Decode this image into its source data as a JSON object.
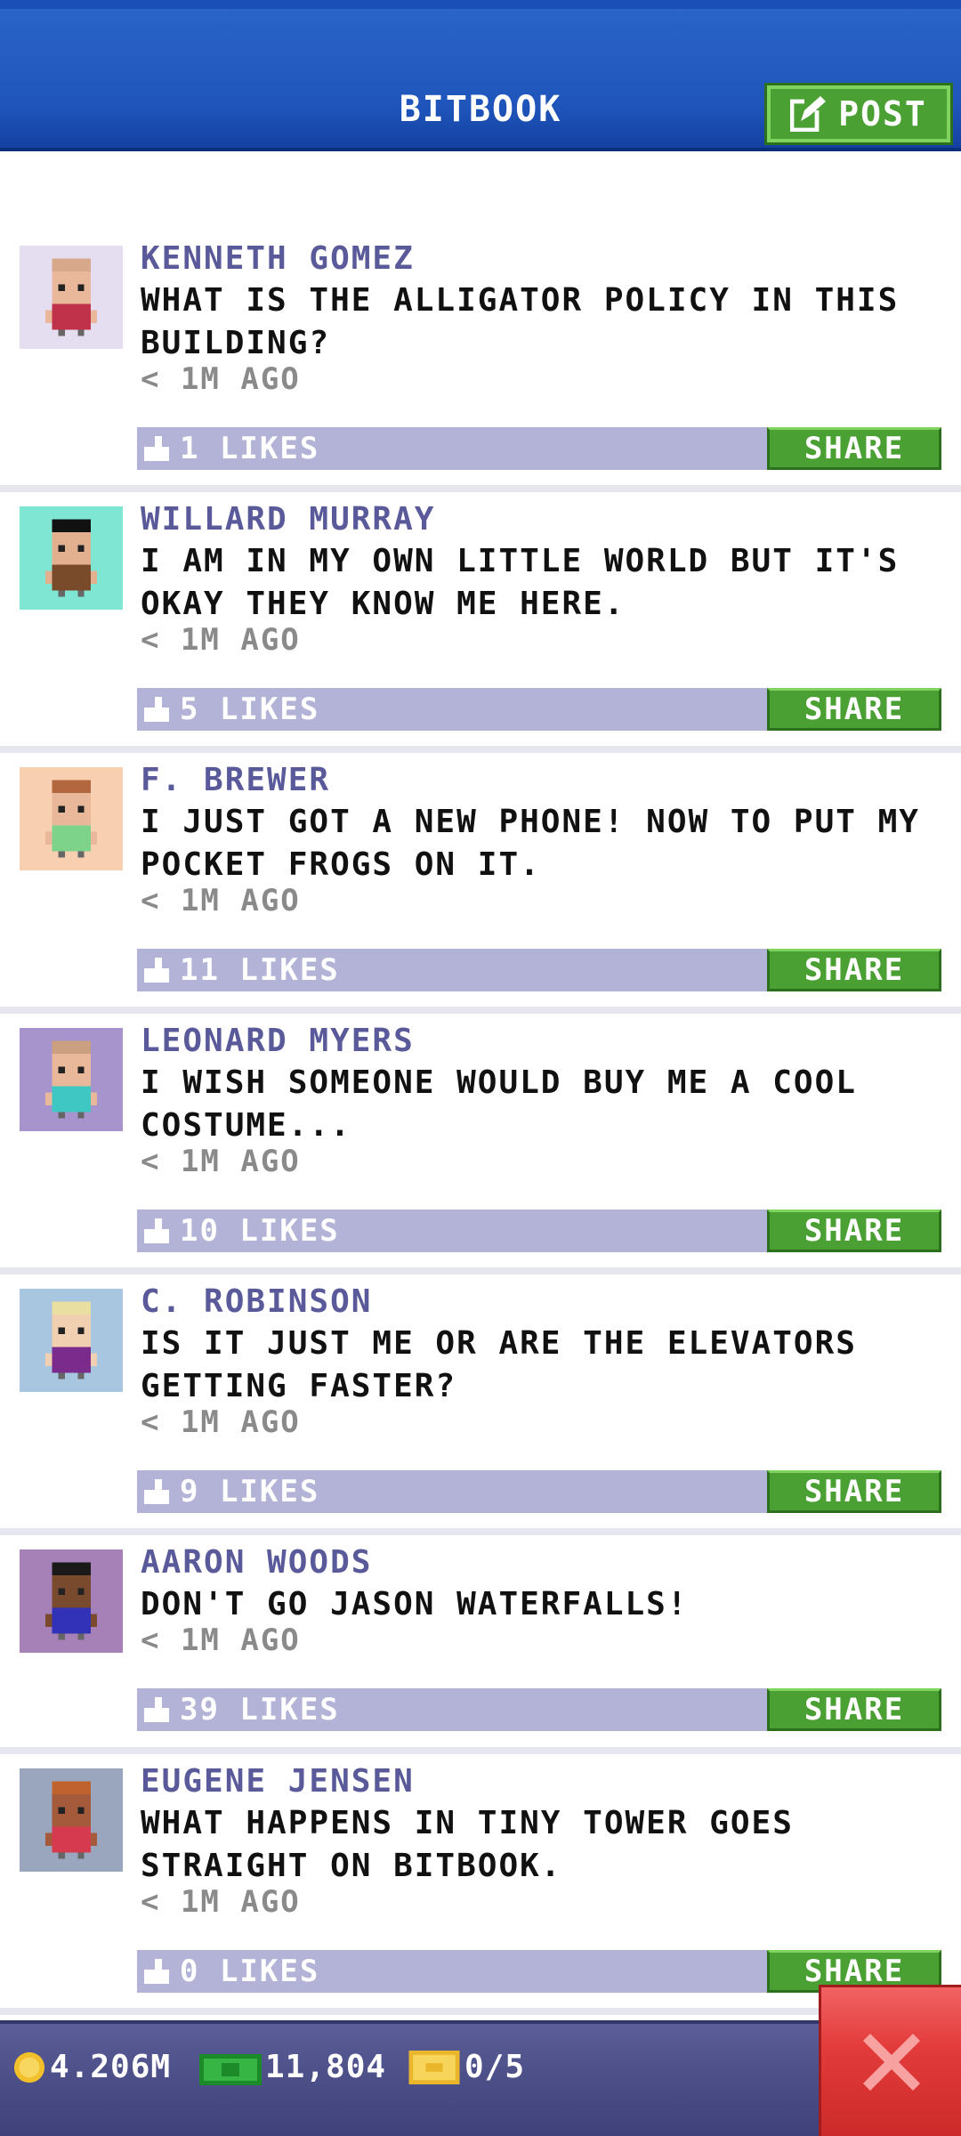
{
  "header": {
    "title": "BITBOOK",
    "post_label": "POST"
  },
  "posts": [
    {
      "name": "KENNETH GOMEZ",
      "message": "WHAT IS THE ALLIGATOR POLICY IN THIS BUILDING?",
      "time": "< 1M AGO",
      "likes": "1 LIKES",
      "share": "SHARE",
      "avatar_bg": "#e5ddf0",
      "shirt": "#c0324a",
      "skin": "#e9b89b",
      "hair": "#d7a98a"
    },
    {
      "name": "WILLARD MURRAY",
      "message": "I AM IN MY OWN LITTLE WORLD BUT IT'S OKAY THEY KNOW ME HERE.",
      "time": "< 1M AGO",
      "likes": "5 LIKES",
      "share": "SHARE",
      "avatar_bg": "#7fe6d3",
      "shirt": "#7a4b2a",
      "skin": "#e2b08f",
      "hair": "#111111"
    },
    {
      "name": "F. BREWER",
      "message": "I JUST GOT A NEW PHONE! NOW TO PUT MY POCKET FROGS ON IT.",
      "time": "< 1M AGO",
      "likes": "11 LIKES",
      "share": "SHARE",
      "avatar_bg": "#f8cfb0",
      "shirt": "#7ed38b",
      "skin": "#e9b89b",
      "hair": "#b3673e"
    },
    {
      "name": "LEONARD MYERS",
      "message": "I WISH SOMEONE WOULD BUY ME A COOL COSTUME...",
      "time": "< 1M AGO",
      "likes": "10 LIKES",
      "share": "SHARE",
      "avatar_bg": "#a794cc",
      "shirt": "#3fc7c4",
      "skin": "#e9b89b",
      "hair": "#caa080"
    },
    {
      "name": "C. ROBINSON",
      "message": "IS IT JUST ME OR ARE THE ELEVATORS GETTING FASTER?",
      "time": "< 1M AGO",
      "likes": "9 LIKES",
      "share": "SHARE",
      "avatar_bg": "#a8c6df",
      "shirt": "#7a2b8c",
      "skin": "#f1cfb1",
      "hair": "#e9dfa0"
    },
    {
      "name": "AARON WOODS",
      "message": "DON'T GO JASON WATERFALLS!",
      "time": "< 1M AGO",
      "likes": "39 LIKES",
      "share": "SHARE",
      "avatar_bg": "#a681b8",
      "shirt": "#3232b8",
      "skin": "#7a4a2e",
      "hair": "#1a1a1a"
    },
    {
      "name": "EUGENE JENSEN",
      "message": "WHAT HAPPENS IN TINY TOWER GOES STRAIGHT ON BITBOOK.",
      "time": "< 1M AGO",
      "likes": "0 LIKES",
      "share": "SHARE",
      "avatar_bg": "#9aa6bd",
      "shirt": "#d63a4f",
      "skin": "#a65a3c",
      "hair": "#c0622e"
    }
  ],
  "footer": {
    "coins": "4.206M",
    "bux": "11,804",
    "tickets": "0/5"
  },
  "colors": {
    "header": "#1f55bb",
    "share_green": "#4aa032",
    "likes_bar": "#b2b3d6",
    "close_red": "#e33b3b"
  }
}
